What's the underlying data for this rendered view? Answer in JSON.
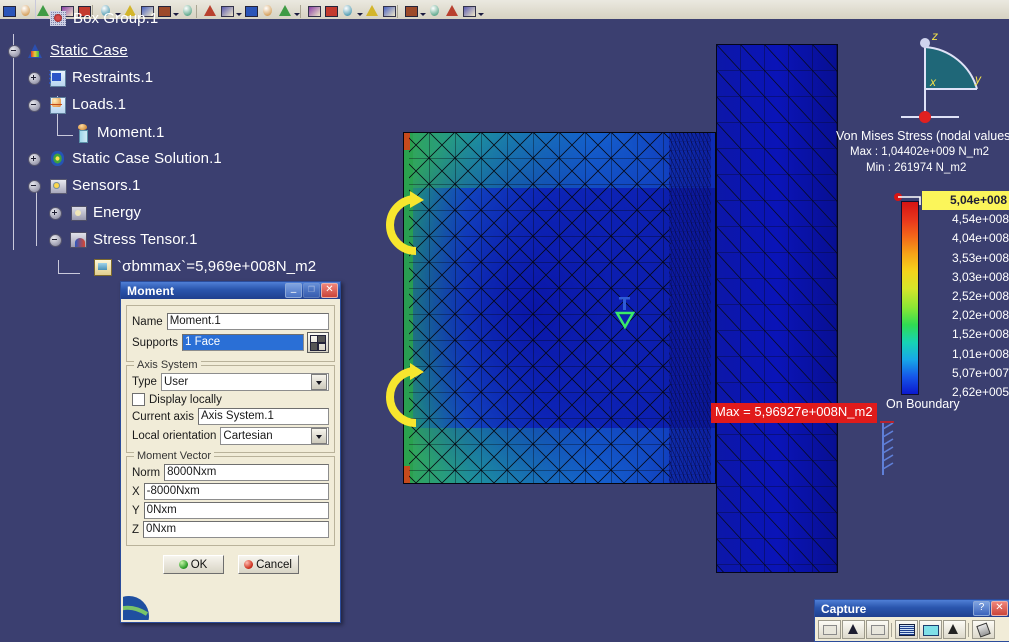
{
  "toolbar": {
    "icons": [
      "open-icon",
      "save-icon",
      "print-icon",
      "undo-icon",
      "cut-icon",
      "copy-icon",
      "measure-icon",
      "apply-material-icon",
      "compute-icon",
      "mesh-icon",
      "restraint-icon",
      "load-icon",
      "sensor-icon",
      "image-icon",
      "analysis-icon",
      "report-icon",
      "view-icon",
      "render-icon",
      "zoom-icon",
      "rotate-icon",
      "light-icon",
      "section-icon",
      "hide-show-icon",
      "swap-icon"
    ]
  },
  "spec_tree": {
    "items": [
      {
        "label": "Box Group.1",
        "icon": "box-group-icon",
        "toggle": "none",
        "underline": false
      },
      {
        "label": "Static Case",
        "icon": "static-case-icon",
        "toggle": "minus",
        "underline": true
      },
      {
        "label": "Restraints.1",
        "icon": "restraints-icon",
        "toggle": "plus",
        "underline": false
      },
      {
        "label": "Loads.1",
        "icon": "loads-icon",
        "toggle": "minus",
        "underline": false
      },
      {
        "label": "Moment.1",
        "icon": "moment-icon",
        "toggle": "none",
        "underline": false
      },
      {
        "label": "Static Case Solution.1",
        "icon": "solution-icon",
        "toggle": "plus",
        "underline": false
      },
      {
        "label": "Sensors.1",
        "icon": "sensors-icon",
        "toggle": "minus",
        "underline": false
      },
      {
        "label": "Energy",
        "icon": "energy-icon",
        "toggle": "plus",
        "underline": false
      },
      {
        "label": "Stress Tensor.1",
        "icon": "stress-tensor-icon",
        "toggle": "minus",
        "underline": false
      },
      {
        "label": "`σbmmax`=5,969e+008N_m2",
        "icon": "sensor-value-icon",
        "toggle": "none",
        "underline": false
      }
    ]
  },
  "legend": {
    "title": "Von Mises Stress (nodal values)",
    "max_line": "Max : 1,04402e+009 N_m2",
    "min_line": "Min : 261974 N_m2",
    "footer": "On Boundary",
    "values": [
      "5,04e+008",
      "4,54e+008",
      "4,04e+008",
      "3,53e+008",
      "3,03e+008",
      "2,52e+008",
      "2,02e+008",
      "1,52e+008",
      "1,01e+008",
      "5,07e+007",
      "2,62e+005"
    ],
    "highlight_index": 0,
    "highlight_color": "#fbf55a"
  },
  "annotations": {
    "max_label": "Max = 5,96927e+008N_m2",
    "max_color": "#e01b1b"
  },
  "axis_triad": {
    "x": "x",
    "y": "y",
    "z": "z"
  },
  "moment_dialog": {
    "title": "Moment",
    "name_label": "Name",
    "name_value": "Moment.1",
    "supports_label": "Supports",
    "supports_value": "1 Face",
    "axis_group": "Axis System",
    "type_label": "Type",
    "type_value": "User",
    "display_locally_label": "Display locally",
    "display_locally_checked": false,
    "current_axis_label": "Current axis",
    "current_axis_value": "Axis System.1",
    "local_orientation_label": "Local orientation",
    "local_orientation_value": "Cartesian",
    "vector_group": "Moment Vector",
    "norm_label": "Norm",
    "norm_value": "8000Nxm",
    "x_label": "X",
    "x_value": "-8000Nxm",
    "y_label": "Y",
    "y_value": "0Nxm",
    "z_label": "Z",
    "z_value": "0Nxm",
    "ok_label": "OK",
    "cancel_label": "Cancel"
  },
  "capture_dialog": {
    "title": "Capture",
    "help_glyph": "?",
    "close_glyph": "✕",
    "tools": [
      "pixel-mode-icon",
      "vector-mode-icon",
      "select-area-icon",
      "capture-icon",
      "preview-icon",
      "album-icon",
      "options-icon"
    ]
  },
  "window_buttons": {
    "minimize_glyph": "–",
    "maximize_glyph": "❐",
    "close_glyph": "✕"
  }
}
